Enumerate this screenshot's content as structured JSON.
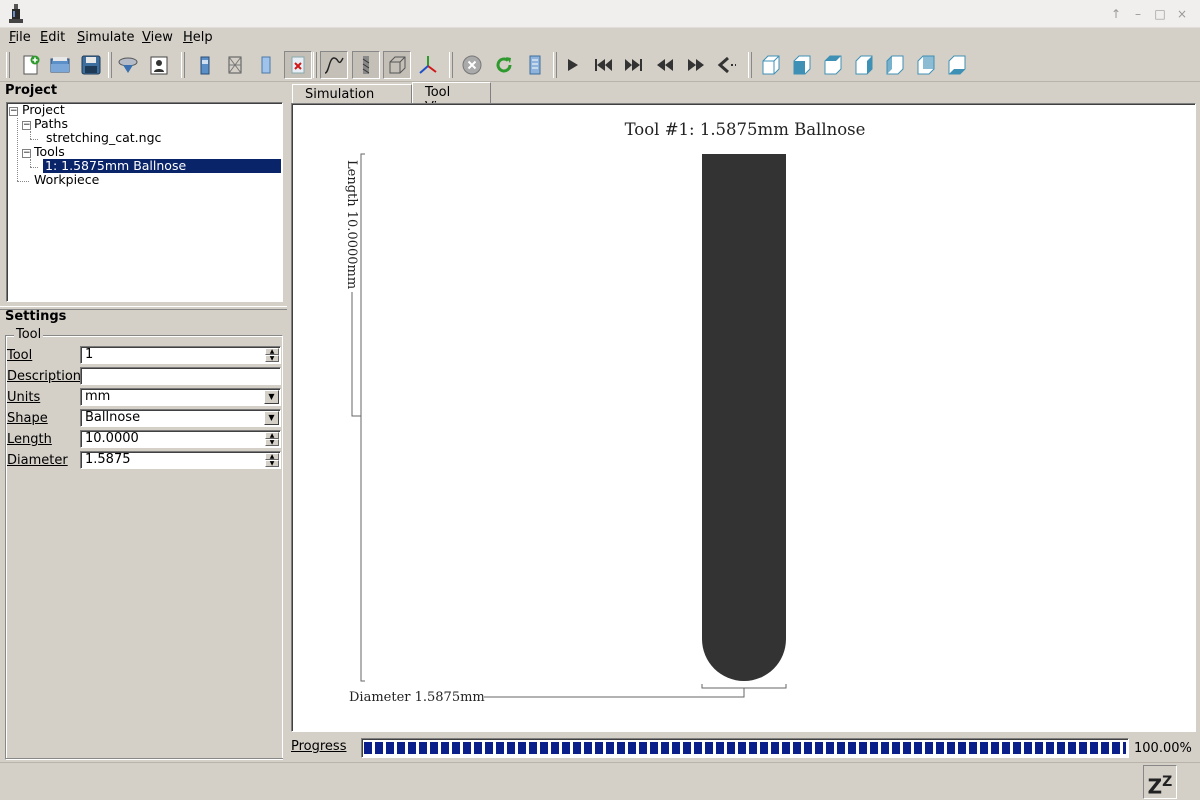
{
  "window": {
    "icons": {
      "app": "application-icon",
      "raise": "up-arrow-icon",
      "minimize": "minimize-icon",
      "maximize": "maximize-icon",
      "close": "close-icon"
    },
    "raise_glyph": "↑",
    "minimize_glyph": "–",
    "maximize_glyph": "□",
    "close_glyph": "×"
  },
  "menu": {
    "file": {
      "accel": "F",
      "rest": "ile"
    },
    "edit": {
      "accel": "E",
      "rest": "dit"
    },
    "simulate": {
      "accel": "S",
      "rest": "imulate"
    },
    "view": {
      "accel": "V",
      "rest": "iew"
    },
    "help": {
      "accel": "H",
      "rest": "elp"
    }
  },
  "toolbar": {
    "groups": [
      [
        "new-project-icon",
        "open-project-icon",
        "save-project-icon"
      ],
      [
        "import-tool-icon",
        "user-profile-icon"
      ],
      [
        "solid-block-icon",
        "wireframe-block-icon",
        "tool-shape-icon",
        "delete-tool-icon"
      ],
      [
        "toggle-path-icon",
        "toggle-tool-icon",
        "toggle-workpiece-icon",
        "toggle-axes-icon"
      ],
      [
        "stop-simulation-icon",
        "reload-icon",
        "simulation-settings-icon"
      ],
      [
        "play-icon",
        "skip-to-start-icon",
        "skip-to-end-icon",
        "step-back-icon",
        "step-forward-icon",
        "step-back-single-icon"
      ],
      [
        "view-iso-icon",
        "view-top-icon",
        "view-front-icon",
        "view-left-icon",
        "view-right-icon",
        "view-back-icon",
        "view-bottom-icon"
      ]
    ]
  },
  "project": {
    "title": "Project",
    "tree": {
      "root": "Project",
      "paths": "Paths",
      "path_file": "stretching_cat.ngc",
      "tools": "Tools",
      "tool_item": "1: 1.5875mm Ballnose",
      "workpiece": "Workpiece"
    },
    "toggle_glyph": "−"
  },
  "settings": {
    "title": "Settings",
    "group": "Tool",
    "fields": {
      "tool": {
        "label": "Tool",
        "value": "1"
      },
      "description": {
        "label": "Description",
        "value": ""
      },
      "units": {
        "label": "Units",
        "value": "mm"
      },
      "shape": {
        "label": "Shape",
        "value": "Ballnose"
      },
      "length": {
        "label": "Length",
        "value": "10.0000"
      },
      "diameter": {
        "label": "Diameter",
        "value": "1.5875"
      }
    },
    "spin_up": "▲",
    "spin_down": "▼",
    "dropdown_glyph": "▼"
  },
  "tabs": {
    "simulation": "Simulation View",
    "tool": "Tool View",
    "active": "Tool View"
  },
  "tool_view": {
    "title": "Tool #1: 1.5875mm Ballnose",
    "length_label": "Length  10.0000mm",
    "diameter_label": "Diameter  1.5875mm",
    "tool_color": "#333333"
  },
  "progress": {
    "label": "Progress",
    "value_text": "100.00%",
    "fraction": 1.0
  },
  "status": {
    "sleep_icon": "sleep-icon",
    "sleep_text": "Z",
    "sleep_sup": "Z"
  }
}
